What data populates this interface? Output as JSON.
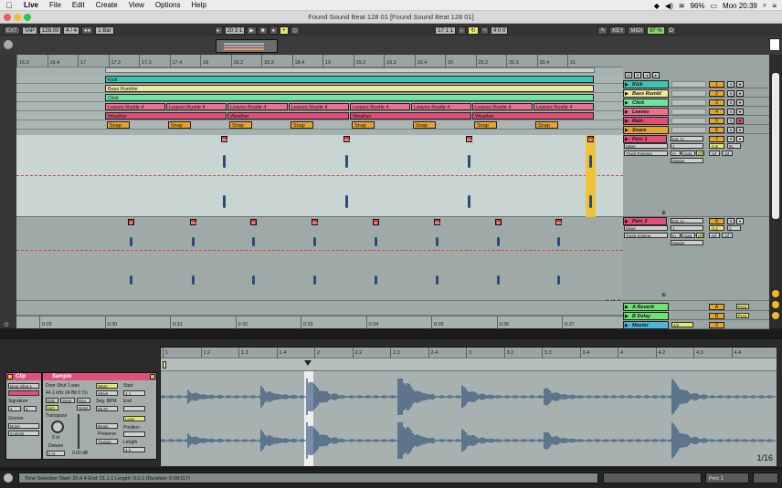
{
  "menubar": {
    "app": "Live",
    "items": [
      "File",
      "Edit",
      "Create",
      "View",
      "Options",
      "Help"
    ],
    "battery": "96%",
    "clock": "Mon 20:39"
  },
  "window": {
    "title": "Found Sound Beat 128 01  [Found Sound Beat 128 01]"
  },
  "control_bar": {
    "tap": "TAP",
    "tempo": "128.00",
    "signature": "4 / 4",
    "quantize": "1 Bar",
    "position": "20  3  1",
    "loop_start": "17  1  1",
    "loop_length": "4  0  0",
    "key": "KEY",
    "midi": "MIDI",
    "cpu": "97 %",
    "d_label": "D"
  },
  "ruler": {
    "bars": [
      "16.3",
      "16.4",
      "17",
      "17.2",
      "17.3",
      "17.4",
      "18",
      "18.2",
      "18.3",
      "18.4",
      "19",
      "19.2",
      "19.3",
      "19.4",
      "20",
      "20.2",
      "20.3",
      "20.4",
      "21"
    ]
  },
  "arrangement": {
    "lanes": [
      {
        "name": "Kick",
        "clips": [
          {
            "label": "Kick"
          }
        ]
      },
      {
        "name": "Bass Rumble",
        "clips": [
          {
            "label": "Bass Rumble"
          }
        ]
      },
      {
        "name": "Click",
        "clips": [
          {
            "label": "Click"
          }
        ]
      },
      {
        "name": "Leaves",
        "clips": [
          {
            "label": "Leaves Rustle 4"
          },
          {
            "label": "Leaves Rustle 4"
          },
          {
            "label": "Leaves Rustle 4"
          },
          {
            "label": "Leaves Rustle 4"
          },
          {
            "label": "Leaves Rustle 4"
          },
          {
            "label": "Leaves Rustle 4"
          },
          {
            "label": "Leaves Rustle 4"
          },
          {
            "label": "Leaves Rustle 4"
          }
        ]
      },
      {
        "name": "Rain",
        "clips": [
          {
            "label": "Weather"
          },
          {
            "label": "Weather"
          },
          {
            "label": "Weather"
          },
          {
            "label": "Weather"
          }
        ]
      },
      {
        "name": "Snare",
        "clips": [
          {
            "label": "Snap"
          },
          {
            "label": "Snap"
          },
          {
            "label": "Snap"
          },
          {
            "label": "Snap"
          },
          {
            "label": "Snap"
          },
          {
            "label": "Snap"
          },
          {
            "label": "Snap"
          },
          {
            "label": "Snap"
          }
        ]
      }
    ],
    "perc1_markers": [
      "Do",
      "Do",
      "Do",
      "Do",
      "Do"
    ],
    "perc2_markers": [
      "D",
      "Do",
      "D",
      "Do",
      "D",
      "Do",
      "D",
      "Do"
    ],
    "grid_label": "1/16",
    "time_ticks": [
      "0:29",
      "0:30",
      "0:31",
      "0:32",
      "0:33",
      "0:34",
      "0:35",
      "0:36",
      "0:37"
    ]
  },
  "tracks": [
    {
      "name": "Kick",
      "number": "1",
      "color": "#3cc5b0"
    },
    {
      "name": "Bass Rumbl",
      "number": "2",
      "color": "#f2e69a"
    },
    {
      "name": "Click",
      "number": "3",
      "color": "#6fe3a0"
    },
    {
      "name": "Leaves",
      "number": "4",
      "color": "#ef6f8e"
    },
    {
      "name": "Rain",
      "number": "5",
      "color": "#e04f7a"
    },
    {
      "name": "Snare",
      "number": "6",
      "color": "#e6a42b"
    }
  ],
  "perc1": {
    "name": "Perc 1",
    "number": "7",
    "input": "Ext. In",
    "input_ch": "1",
    "monitor_options": [
      "In",
      "Auto",
      "Off"
    ],
    "route": "Mixer",
    "master": "Master",
    "automation": "Track Panning",
    "volume": "-1.8",
    "pan": "8L",
    "send_a": "-inf",
    "send_b": "-inf"
  },
  "perc2": {
    "name": "Perc 2",
    "number": "8",
    "input": "Ext. In",
    "input_ch": "1",
    "monitor_options": [
      "In",
      "Auto",
      "Off"
    ],
    "route": "Mixer",
    "master": "Master",
    "automation": "Track Volume",
    "volume": "-2.2",
    "pan": "C",
    "send_a": "-inf",
    "send_b": "-inf"
  },
  "returns": [
    {
      "name": "A Reverb",
      "letter": "A",
      "button": "Post",
      "color": "#6fe36f"
    },
    {
      "name": "B Delay",
      "letter": "B",
      "button": "Post",
      "color": "#6fe36f"
    },
    {
      "name": "Master",
      "letter": "0",
      "button": "1/2",
      "color": "#4fb5d6"
    }
  ],
  "detail": {
    "clip": {
      "title": "Clip",
      "name": "Door Shut 1",
      "signature_label": "Signature",
      "sig_num": "4",
      "sig_den": "4",
      "groove_label": "Groove",
      "groove_value": "None",
      "commit": "Commit"
    },
    "sample": {
      "title": "Sample",
      "file": "Door Shut 1.wav",
      "info": "44.1 kHz 24 Bit 2 Ch",
      "edit": "Edit",
      "save": "Save",
      "rev": "Rev.",
      "hiq": "HiQ",
      "ram": "RAM",
      "transpose_label": "Transpose",
      "transpose_value": "0 st",
      "detune_label": "Detune",
      "detune_value": "0 ct",
      "gain_value": "0.00 dB",
      "warp": "Warp",
      "slave": "Slave",
      "seg_bpm_label": "Seg. BPM",
      "seg_bpm": "85.97",
      "mode": "Beats",
      "preserve_label": "Preserve",
      "transients": "Transie",
      "start_label": "Start",
      "start_value": "1  1",
      "end_label": "End",
      "loop_label": "Loop",
      "position_label": "Position",
      "length_label": "Length",
      "length_value": "4  0"
    },
    "wave_ruler": [
      "1",
      "1.2",
      "1.3",
      "1.4",
      "2",
      "2.2",
      "2.3",
      "2.4",
      "3",
      "3.2",
      "3.3",
      "3.4",
      "4",
      "4.2",
      "4.3",
      "4.4"
    ],
    "grid_label": "1/16"
  },
  "status": {
    "text": "Time Selection   Start: 20.4.4   End: 21.1.1   Length: 0.0.1 (Duration: 0:00:117)",
    "track": "Perc 1"
  }
}
